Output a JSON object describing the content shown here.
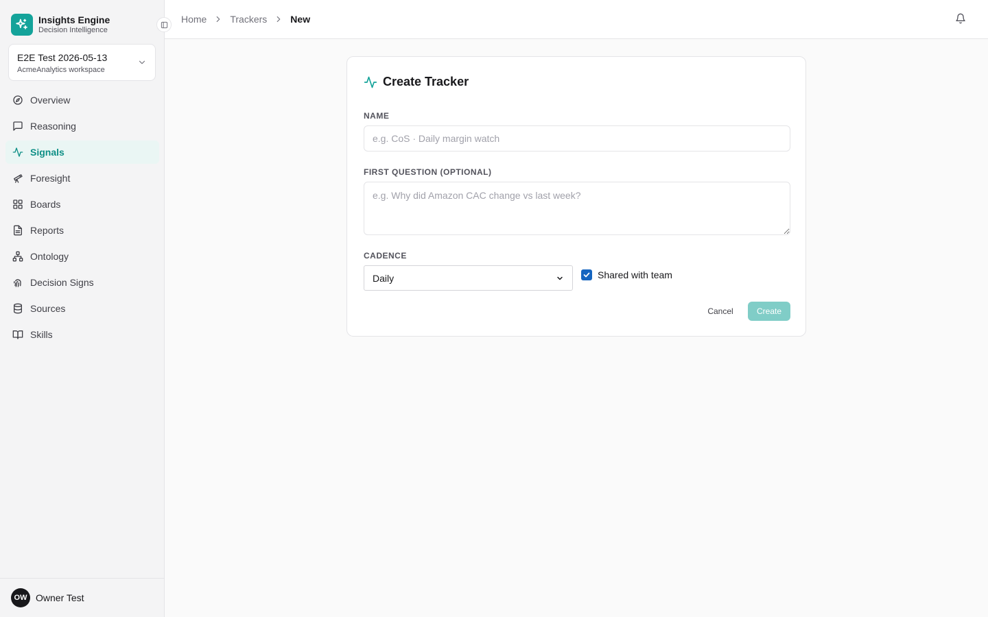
{
  "brand": {
    "name": "Insights Engine",
    "subtitle": "Decision Intelligence",
    "logo_icon": "sparkles-icon",
    "accent": "#14a39a"
  },
  "workspace": {
    "name": "E2E Test 2026-05-13",
    "subtitle": "AcmeAnalytics workspace"
  },
  "sidebar": {
    "items": [
      {
        "label": "Overview",
        "icon": "compass-icon",
        "active": false
      },
      {
        "label": "Reasoning",
        "icon": "message-square-icon",
        "active": false
      },
      {
        "label": "Signals",
        "icon": "activity-icon",
        "active": true
      },
      {
        "label": "Foresight",
        "icon": "telescope-icon",
        "active": false
      },
      {
        "label": "Boards",
        "icon": "layout-grid-icon",
        "active": false
      },
      {
        "label": "Reports",
        "icon": "file-text-icon",
        "active": false
      },
      {
        "label": "Ontology",
        "icon": "network-icon",
        "active": false
      },
      {
        "label": "Decision Signs",
        "icon": "fingerprint-icon",
        "active": false
      },
      {
        "label": "Sources",
        "icon": "database-icon",
        "active": false
      },
      {
        "label": "Skills",
        "icon": "book-open-icon",
        "active": false
      }
    ]
  },
  "user": {
    "initials": "OW",
    "name": "Owner Test"
  },
  "breadcrumb": {
    "items": [
      "Home",
      "Trackers",
      "New"
    ]
  },
  "form": {
    "title": "Create Tracker",
    "name_label": "NAME",
    "name_value": "",
    "name_placeholder": "e.g. CoS · Daily margin watch",
    "question_label": "FIRST QUESTION (OPTIONAL)",
    "question_value": "",
    "question_placeholder": "e.g. Why did Amazon CAC change vs last week?",
    "cadence_label": "CADENCE",
    "cadence_value": "Daily",
    "shared_label": "Shared with team",
    "shared_checked": true,
    "cancel_label": "Cancel",
    "create_label": "Create"
  },
  "colors": {
    "accent": "#14a39a",
    "active_nav_bg": "#eaf6f4",
    "create_button": "#80cdc7",
    "checkbox": "#1565c0"
  }
}
